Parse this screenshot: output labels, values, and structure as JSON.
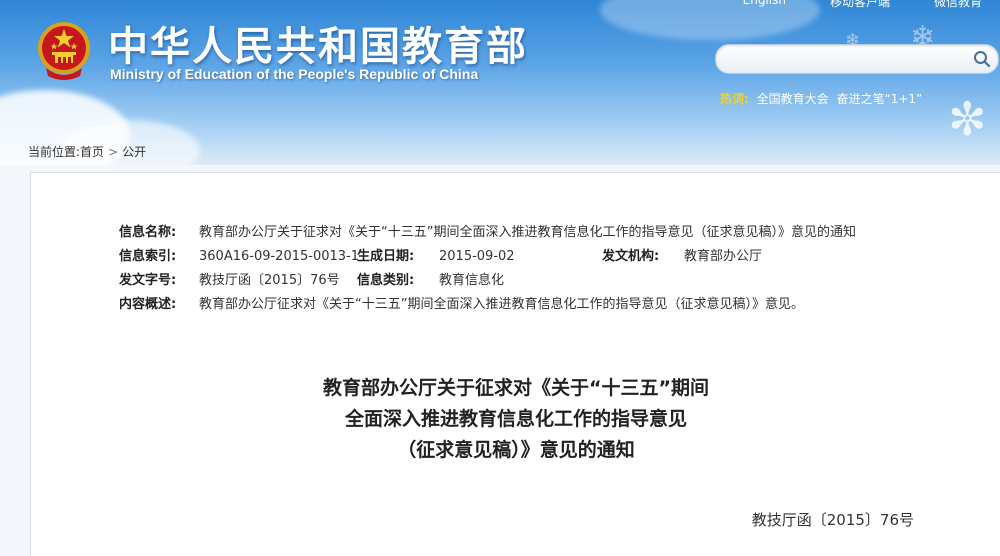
{
  "header": {
    "title": "中华人民共和国教育部",
    "subtitle": "Ministry of Education of the People's Republic of China",
    "top_links": [
      "English",
      "移动客户端",
      "微信教育"
    ],
    "emblem_icon": "national-emblem-icon",
    "search": {
      "placeholder": "",
      "value": "",
      "icon": "search-icon"
    },
    "hot": {
      "label": "热词:",
      "items": [
        "全国教育大会",
        "奋进之笔“1+1”"
      ]
    },
    "colors": {
      "sky_top": "#2f86d6",
      "sky_bottom": "#dceaf7",
      "hot_label": "#f2d22a"
    }
  },
  "breadcrumb": {
    "prefix": "当前位置:",
    "items": [
      "首页",
      "公开"
    ],
    "separator": ">"
  },
  "meta": {
    "info_name_label": "信息名称:",
    "info_name": "教育部办公厅关于征求对《关于“十三五”期间全面深入推进教育信息化工作的指导意见（征求意见稿）》意见的通知",
    "index_label": "信息索引:",
    "index": "360A16-09-2015-0013-1",
    "date_label": "生成日期:",
    "date": "2015-09-02",
    "issuer_label": "发文机构:",
    "issuer": "教育部办公厅",
    "doc_no_label": "发文字号:",
    "doc_no": "教技厅函〔2015〕76号",
    "category_label": "信息类别:",
    "category": "教育信息化",
    "summary_label": "内容概述:",
    "summary": "教育部办公厅征求对《关于“十三五”期间全面深入推进教育信息化工作的指导意见（征求意见稿）》意见。"
  },
  "document": {
    "title_lines": [
      "教育部办公厅关于征求对《关于“十三五”期间",
      "全面深入推进教育信息化工作的指导意见",
      "（征求意见稿）》意见的通知"
    ],
    "number": "教技厅函〔2015〕76号"
  }
}
